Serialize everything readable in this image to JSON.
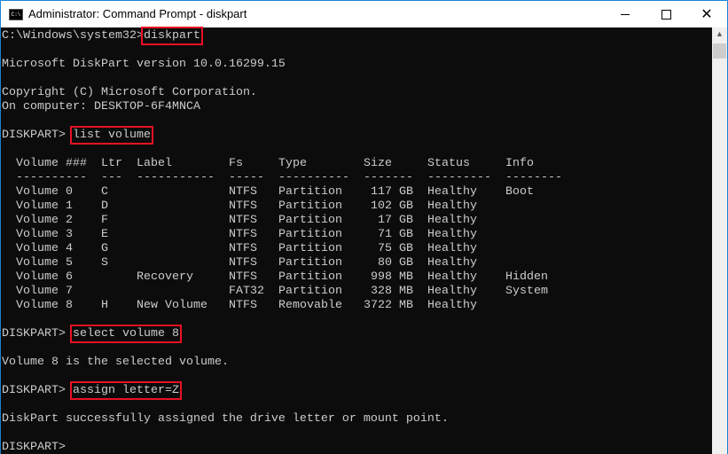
{
  "window": {
    "title": "Administrator: Command Prompt - diskpart",
    "icon": "cmd-icon",
    "controls": [
      "minimize-icon",
      "maximize-icon",
      "close-icon"
    ]
  },
  "console": {
    "prompt1": "C:\\Windows\\system32>",
    "cmd1": "diskpart",
    "version": "Microsoft DiskPart version 10.0.16299.15",
    "copyright": "Copyright (C) Microsoft Corporation.",
    "computer": "On computer: DESKTOP-6F4MNCA",
    "prompt": "DISKPART> ",
    "cmd2": "list volume",
    "table": {
      "headers": [
        "Volume ###",
        "Ltr",
        "Label",
        "Fs",
        "Type",
        "Size",
        "Status",
        "Info"
      ],
      "dashes": [
        "----------",
        "---",
        "-----------",
        "-----",
        "----------",
        "-------",
        "---------",
        "--------"
      ],
      "rows": [
        [
          "Volume 0",
          "C",
          "",
          "NTFS",
          "Partition",
          "117 GB",
          "Healthy",
          "Boot"
        ],
        [
          "Volume 1",
          "D",
          "",
          "NTFS",
          "Partition",
          "102 GB",
          "Healthy",
          ""
        ],
        [
          "Volume 2",
          "F",
          "",
          "NTFS",
          "Partition",
          "17 GB",
          "Healthy",
          ""
        ],
        [
          "Volume 3",
          "E",
          "",
          "NTFS",
          "Partition",
          "71 GB",
          "Healthy",
          ""
        ],
        [
          "Volume 4",
          "G",
          "",
          "NTFS",
          "Partition",
          "75 GB",
          "Healthy",
          ""
        ],
        [
          "Volume 5",
          "S",
          "",
          "NTFS",
          "Partition",
          "80 GB",
          "Healthy",
          ""
        ],
        [
          "Volume 6",
          "",
          "Recovery",
          "NTFS",
          "Partition",
          "998 MB",
          "Healthy",
          "Hidden"
        ],
        [
          "Volume 7",
          "",
          "",
          "FAT32",
          "Partition",
          "328 MB",
          "Healthy",
          "System"
        ],
        [
          "Volume 8",
          "H",
          "New Volume",
          "NTFS",
          "Removable",
          "3722 MB",
          "Healthy",
          ""
        ]
      ]
    },
    "cmd3": "select volume 8",
    "msg3": "Volume 8 is the selected volume.",
    "cmd4": "assign letter=Z",
    "msg4": "DiskPart successfully assigned the drive letter or mount point."
  }
}
